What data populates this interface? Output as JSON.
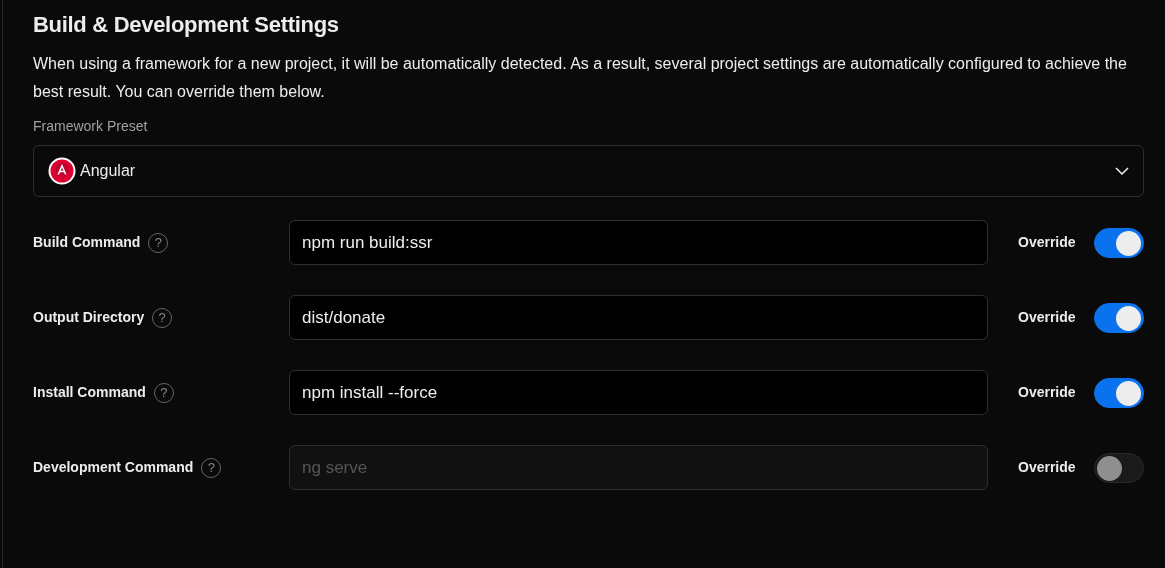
{
  "title": "Build & Development Settings",
  "description": "When using a framework for a new project, it will be automatically detected. As a result, several project settings are automatically configured to achieve the best result. You can override them below.",
  "framework_preset": {
    "label": "Framework Preset",
    "value": "Angular"
  },
  "settings": [
    {
      "label": "Build Command",
      "help": "?",
      "value": "npm run build:ssr",
      "disabled": false,
      "override_label": "Override",
      "override": true
    },
    {
      "label": "Output Directory",
      "help": "?",
      "value": "dist/donate",
      "disabled": false,
      "override_label": "Override",
      "override": true
    },
    {
      "label": "Install Command",
      "help": "?",
      "value": "npm install --force",
      "disabled": false,
      "override_label": "Override",
      "override": true
    },
    {
      "label": "Development Command",
      "help": "?",
      "placeholder": "ng serve",
      "disabled": true,
      "override_label": "Override",
      "override": false
    }
  ]
}
